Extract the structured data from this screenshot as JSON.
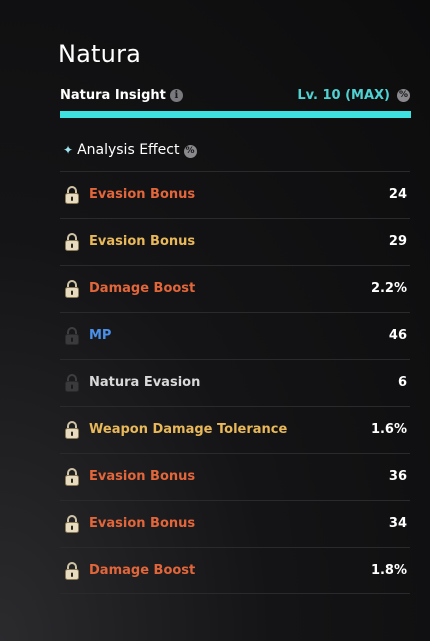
{
  "title": "Natura",
  "insight": {
    "label": "Natura Insight",
    "level": "Lv. 10 (MAX)",
    "progress": 1.0
  },
  "analysis": {
    "label": "Analysis Effect"
  },
  "colors": {
    "accent_cyan": "#3fe0e0",
    "orange": "#e2663a",
    "gold": "#e8b859",
    "blue": "#4a8fe8",
    "white": "#d9d9d9"
  },
  "effects": [
    {
      "label": "Evasion Bonus",
      "value": "24",
      "color": "orange",
      "lock": "gold-lock-icon"
    },
    {
      "label": "Evasion Bonus",
      "value": "29",
      "color": "gold",
      "lock": "gold-lock-icon"
    },
    {
      "label": "Damage Boost",
      "value": "2.2%",
      "color": "orange",
      "lock": "gold-lock-icon"
    },
    {
      "label": "MP",
      "value": "46",
      "color": "blue",
      "lock": "gray-lock-icon"
    },
    {
      "label": "Natura Evasion",
      "value": "6",
      "color": "white",
      "lock": "gray-lock-icon"
    },
    {
      "label": "Weapon Damage Tolerance",
      "value": "1.6%",
      "color": "gold",
      "lock": "gold-lock-icon"
    },
    {
      "label": "Evasion Bonus",
      "value": "36",
      "color": "orange",
      "lock": "gold-lock-icon"
    },
    {
      "label": "Evasion Bonus",
      "value": "34",
      "color": "orange",
      "lock": "gold-lock-icon"
    },
    {
      "label": "Damage Boost",
      "value": "1.8%",
      "color": "orange",
      "lock": "gold-lock-icon"
    }
  ]
}
